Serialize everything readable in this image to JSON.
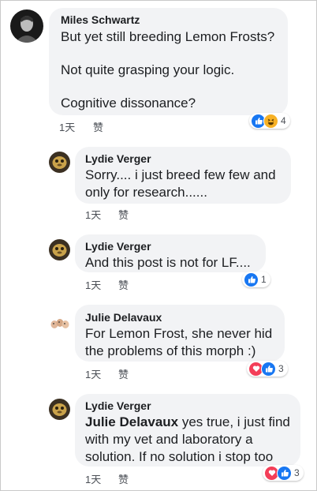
{
  "comments": [
    {
      "author": "Miles Schwartz",
      "lines": [
        "But yet still breeding Lemon Frosts?",
        "",
        "Not quite grasping your logic.",
        "",
        "Cognitive dissonance?"
      ],
      "time": "1天",
      "like_label": "赞",
      "reactions": [
        "like-icon",
        "haha-icon"
      ],
      "reaction_count": "4"
    },
    {
      "author": "Lydie Verger",
      "lines": [
        "Sorry.... i just breed few few and",
        "only for research......"
      ],
      "time": "1天",
      "like_label": "赞"
    },
    {
      "author": "Lydie Verger",
      "lines": [
        "And this post is not for LF...."
      ],
      "time": "1天",
      "like_label": "赞",
      "reactions": [
        "like-icon"
      ],
      "reaction_count": "1"
    },
    {
      "author": "Julie Delavaux",
      "lines": [
        "For Lemon Frost, she never hid",
        "the problems of this morph :)"
      ],
      "time": "1天",
      "like_label": "赞",
      "reactions": [
        "love-icon",
        "like-icon"
      ],
      "reaction_count": "3"
    },
    {
      "author": "Lydie Verger",
      "mention": "Julie Delavaux",
      "lines": [
        " yes true, i just find",
        "with my vet and laboratory a",
        "solution. If no solution i stop too"
      ],
      "time": "1天",
      "like_label": "赞",
      "reactions": [
        "love-icon",
        "like-icon"
      ],
      "reaction_count": "3"
    }
  ],
  "colors": {
    "bubble": "#f2f3f5",
    "like": "#1877f2",
    "love": "#f33e58",
    "haha": "#f7b125"
  }
}
